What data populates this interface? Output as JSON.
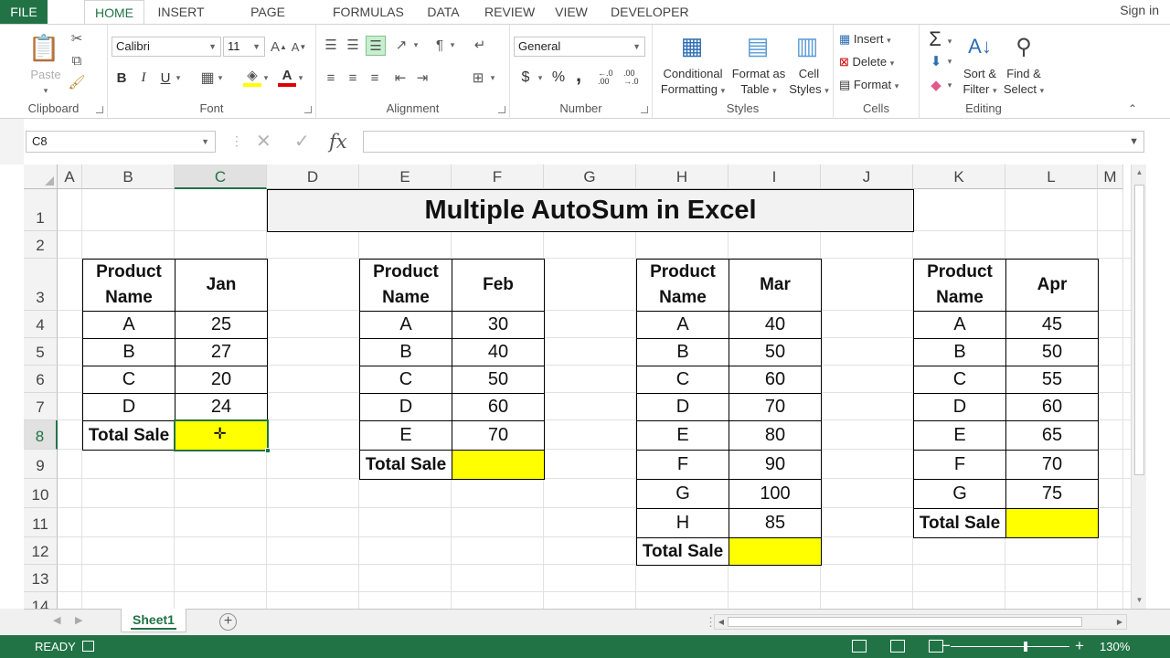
{
  "ribbon_tabs": [
    "FILE",
    "HOME",
    "INSERT",
    "PAGE LAYOUT",
    "FORMULAS",
    "DATA",
    "REVIEW",
    "VIEW",
    "DEVELOPER"
  ],
  "active_tab": "HOME",
  "sign_in": "Sign in",
  "clipboard": {
    "label": "Clipboard",
    "paste": "Paste"
  },
  "font": {
    "label": "Font",
    "name": "Calibri",
    "size": "11",
    "bold": "B",
    "italic": "I",
    "underline": "U"
  },
  "alignment": {
    "label": "Alignment"
  },
  "number": {
    "label": "Number",
    "format": "General",
    "currency": "$",
    "percent": "%",
    "comma": ",",
    "increase_decimal": "←.0 .00",
    "decrease_decimal": ".00 →.0"
  },
  "styles": {
    "label": "Styles",
    "conditional_line1": "Conditional",
    "conditional_line2": "Formatting",
    "format_table_line1": "Format as",
    "format_table_line2": "Table",
    "cell_styles_line1": "Cell",
    "cell_styles_line2": "Styles"
  },
  "cells": {
    "label": "Cells",
    "insert": "Insert",
    "delete": "Delete",
    "format": "Format"
  },
  "editing": {
    "label": "Editing",
    "autosum": "Σ",
    "sort_line1": "Sort &",
    "sort_line2": "Filter",
    "find_line1": "Find &",
    "find_line2": "Select"
  },
  "formula_bar": {
    "name_box": "C8",
    "fx": "fx",
    "value": ""
  },
  "columns": [
    "A",
    "B",
    "C",
    "D",
    "E",
    "F",
    "G",
    "H",
    "I",
    "J",
    "K",
    "L",
    "M"
  ],
  "selected_column": "C",
  "rows": [
    "1",
    "2",
    "3",
    "4",
    "5",
    "6",
    "7",
    "8",
    "9",
    "10",
    "11",
    "12",
    "13",
    "14"
  ],
  "selected_row": "8",
  "sheet_title": "Multiple AutoSum in Excel",
  "tables": [
    {
      "product_header": "Product Name",
      "month": "Jan",
      "products": [
        "A",
        "B",
        "C",
        "D"
      ],
      "values": [
        "25",
        "27",
        "20",
        "24"
      ],
      "total_label": "Total Sale",
      "total_value": ""
    },
    {
      "product_header": "Product Name",
      "month": "Feb",
      "products": [
        "A",
        "B",
        "C",
        "D",
        "E"
      ],
      "values": [
        "30",
        "40",
        "50",
        "60",
        "70"
      ],
      "total_label": "Total Sale",
      "total_value": ""
    },
    {
      "product_header": "Product Name",
      "month": "Mar",
      "products": [
        "A",
        "B",
        "C",
        "D",
        "E",
        "F",
        "G",
        "H"
      ],
      "values": [
        "40",
        "50",
        "60",
        "70",
        "80",
        "90",
        "100",
        "85"
      ],
      "total_label": "Total Sale",
      "total_value": ""
    },
    {
      "product_header": "Product Name",
      "month": "Apr",
      "products": [
        "A",
        "B",
        "C",
        "D",
        "E",
        "F",
        "G"
      ],
      "values": [
        "45",
        "50",
        "55",
        "60",
        "65",
        "70",
        "75"
      ],
      "total_label": "Total Sale",
      "total_value": ""
    }
  ],
  "sheet_tab": "Sheet1",
  "status": {
    "ready": "READY",
    "zoom": "130%"
  },
  "colors": {
    "excel_green": "#217346",
    "total_highlight": "#ffff00",
    "title_fill": "#f2f2f2"
  }
}
